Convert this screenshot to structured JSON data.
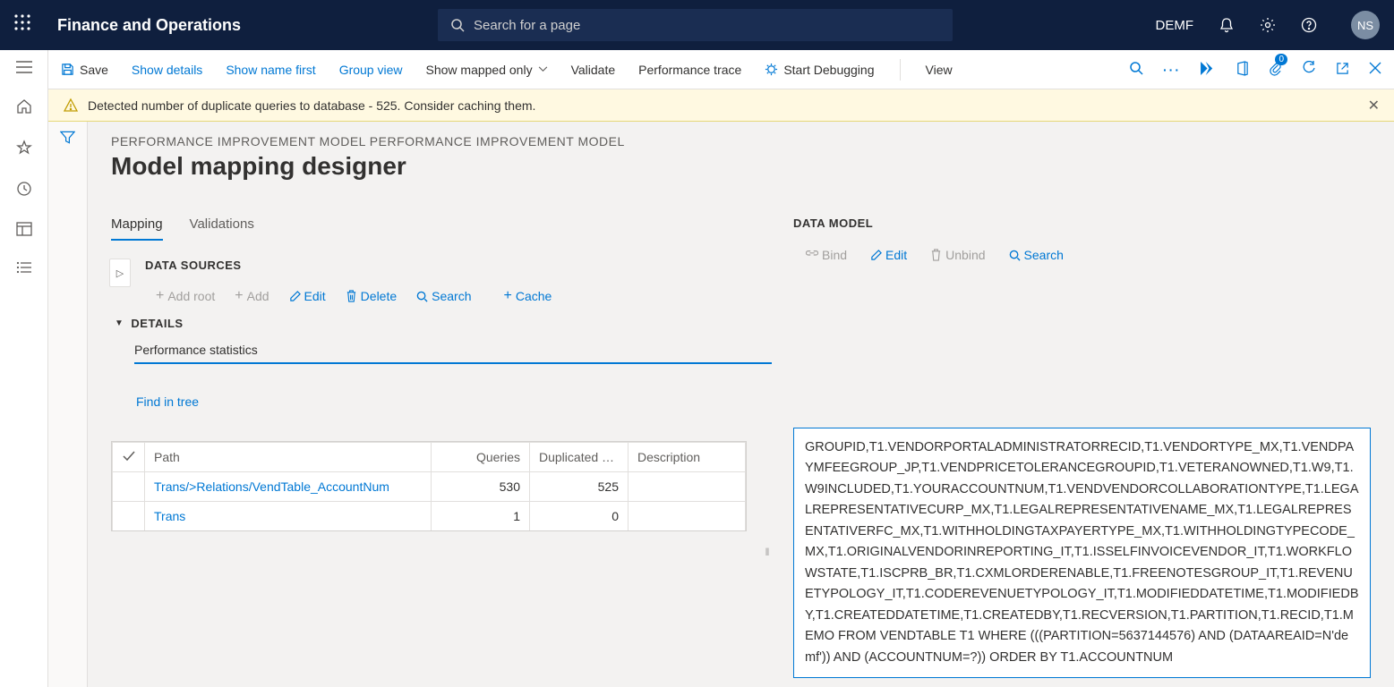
{
  "topbar": {
    "title": "Finance and Operations",
    "searchPlaceholder": "Search for a page",
    "entity": "DEMF",
    "avatar": "NS"
  },
  "actionbar": {
    "save": "Save",
    "showDetails": "Show details",
    "showNameFirst": "Show name first",
    "groupView": "Group view",
    "showMappedOnly": "Show mapped only",
    "validate": "Validate",
    "perfTrace": "Performance trace",
    "startDebugging": "Start Debugging",
    "view": "View",
    "attachmentsBadge": "0"
  },
  "warning": "Detected number of duplicate queries to database - 525. Consider caching them.",
  "breadcrumb": "PERFORMANCE IMPROVEMENT MODEL PERFORMANCE IMPROVEMENT MODEL",
  "pageTitle": "Model mapping designer",
  "tabs": {
    "mapping": "Mapping",
    "validations": "Validations"
  },
  "dataSources": {
    "heading": "DATA SOURCES",
    "addRoot": "Add root",
    "add": "Add",
    "edit": "Edit",
    "delete": "Delete",
    "search": "Search",
    "cache": "Cache"
  },
  "details": {
    "heading": "DETAILS",
    "statsTab": "Performance statistics",
    "findInTree": "Find in tree"
  },
  "table": {
    "headers": {
      "path": "Path",
      "queries": "Queries",
      "dup": "Duplicated que...",
      "desc": "Description"
    },
    "rows": [
      {
        "path": "Trans/>Relations/VendTable_AccountNum",
        "queries": "530",
        "dup": "525",
        "desc": ""
      },
      {
        "path": "Trans",
        "queries": "1",
        "dup": "0",
        "desc": ""
      }
    ]
  },
  "dataModel": {
    "heading": "DATA MODEL",
    "bind": "Bind",
    "edit": "Edit",
    "unbind": "Unbind",
    "search": "Search"
  },
  "sql": "GROUPID,T1.VENDORPORTALADMINISTRATORRECID,T1.VENDORTYPE_MX,T1.VENDPAYMFEEGROUP_JP,T1.VENDPRICETOLERANCEGROUPID,T1.VETERANOWNED,T1.W9,T1.W9INCLUDED,T1.YOURACCOUNTNUM,T1.VENDVENDORCOLLABORATIONTYPE,T1.LEGALREPRESENTATIVECURP_MX,T1.LEGALREPRESENTATIVENAME_MX,T1.LEGALREPRESENTATIVERFC_MX,T1.WITHHOLDINGTAXPAYERTYPE_MX,T1.WITHHOLDINGTYPECODE_MX,T1.ORIGINALVENDORINREPORTING_IT,T1.ISSELFINVOICEVENDOR_IT,T1.WORKFLOWSTATE,T1.ISCPRB_BR,T1.CXMLORDERENABLE,T1.FREENOTESGROUP_IT,T1.REVENUETYPOLOGY_IT,T1.CODEREVENUETYPOLOGY_IT,T1.MODIFIEDDATETIME,T1.MODIFIEDBY,T1.CREATEDDATETIME,T1.CREATEDBY,T1.RECVERSION,T1.PARTITION,T1.RECID,T1.MEMO FROM VENDTABLE T1 WHERE (((PARTITION=5637144576) AND (DATAAREAID=N'demf')) AND (ACCOUNTNUM=?)) ORDER BY T1.ACCOUNTNUM"
}
